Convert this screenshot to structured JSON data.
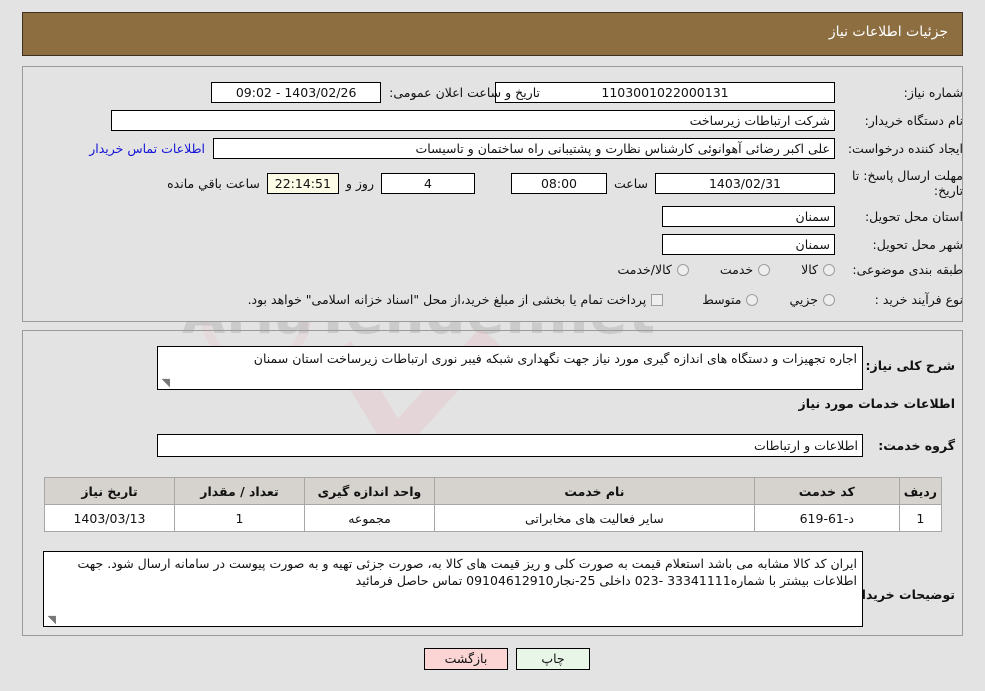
{
  "header": {
    "title": "جزئیات اطلاعات نیاز"
  },
  "form": {
    "need_number_label": "شماره نیاز:",
    "need_number_value": "1103001022000131",
    "announce_datetime_label": "تاریخ و ساعت اعلان عمومی:",
    "announce_datetime_value": "1403/02/26 - 09:02",
    "buyer_org_label": "نام دستگاه خریدار:",
    "buyer_org_value": "شرکت ارتباطات زیرساخت",
    "requester_label": "ایجاد کننده درخواست:",
    "requester_value": "علی اکبر رضائی آهوانوئی کارشناس نظارت و پشتیبانی راه ساختمان و تاسیسات",
    "buyer_contact_link": "اطلاعات تماس خریدار",
    "deadline_label": "مهلت ارسال پاسخ: تا تاریخ:",
    "deadline_date": "1403/02/31",
    "deadline_hour_label": "ساعت",
    "deadline_hour": "08:00",
    "remaining_days": "4",
    "days_and_label": "روز و",
    "remaining_time": "22:14:51",
    "remaining_suffix": "ساعت باقي مانده",
    "province_label": "استان محل تحویل:",
    "province_value": "سمنان",
    "city_label": "شهر محل تحویل:",
    "city_value": "سمنان",
    "category_label": "طبقه بندی موضوعی:",
    "category_options": [
      "کالا",
      "خدمت",
      "کالا/خدمت"
    ],
    "process_label": "نوع فرآیند خرید :",
    "process_options": [
      "جزیي",
      "متوسط"
    ],
    "treasury_note": "پرداخت تمام یا بخشی از مبلغ خرید،از محل \"اسناد خزانه اسلامی\" خواهد بود."
  },
  "description": {
    "general_label": "شرح کلی نیاز:",
    "general_value": "اجاره تجهیزات و دستگاه های اندازه گیری مورد نیاز جهت نگهداری شبکه فیبر نوری ارتباطات زیرساخت استان سمنان",
    "services_heading": "اطلاعات خدمات مورد نیاز",
    "service_group_label": "گروه خدمت:",
    "service_group_value": "اطلاعات و ارتباطات"
  },
  "table": {
    "columns": [
      "ردیف",
      "کد خدمت",
      "نام خدمت",
      "واحد اندازه گیری",
      "تعداد / مقدار",
      "تاریخ نیاز"
    ],
    "rows": [
      {
        "index": "1",
        "service_code": "د-61-619",
        "service_name": "سایر فعالیت های مخابراتی",
        "unit": "مجموعه",
        "quantity": "1",
        "need_date": "1403/03/13"
      }
    ]
  },
  "buyer_notes": {
    "label": "توضیحات خریدار:",
    "value": "ایران کد کالا مشابه می باشد استعلام قیمت به صورت کلی و ریز قیمت های کالا به، صورت جزئی تهیه و به صورت پیوست در سامانه ارسال شود. جهت اطلاعات بیشتر با شماره33341111 -023 داخلی 25-نجار09104612910 تماس حاصل فرمائید"
  },
  "actions": {
    "print_label": "چاپ",
    "back_label": "بازگشت"
  },
  "watermark": {
    "text": "AriaTender.net"
  },
  "colors": {
    "header_brown": "#8d6e41",
    "link_blue": "#1414d8",
    "back_button": "#fbd4d4",
    "print_button": "#e8f6e8",
    "countdown_bg": "#fbfbe6"
  }
}
